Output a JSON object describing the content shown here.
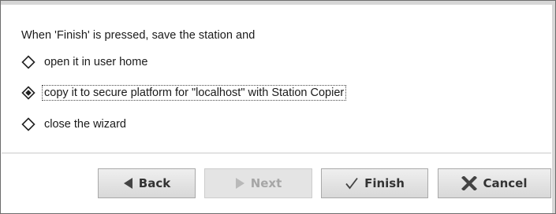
{
  "wizard": {
    "prompt": "When 'Finish' is pressed, save the station and",
    "options": [
      {
        "label": "open it in user home",
        "selected": false
      },
      {
        "label": "copy it to secure platform for \"localhost\" with Station Copier",
        "selected": true
      },
      {
        "label": "close the wizard",
        "selected": false
      }
    ]
  },
  "buttons": {
    "back": "Back",
    "next": "Next",
    "finish": "Finish",
    "cancel": "Cancel"
  },
  "icons": {
    "back": "triangle-left-icon",
    "next": "triangle-right-icon",
    "finish": "checkmark-icon",
    "cancel": "x-icon"
  },
  "colors": {
    "text": "#1a1a1a",
    "disabled_text": "#a6a6a6",
    "cancel_icon": "#444444"
  }
}
